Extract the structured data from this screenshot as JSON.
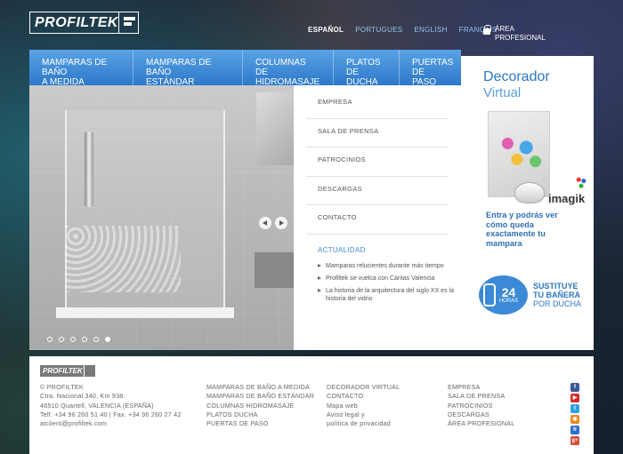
{
  "header": {
    "logo_text": "PROFILTEK",
    "languages": [
      "ESPAÑOL",
      "PORTUGUES",
      "ENGLISH",
      "FRANÇAIS"
    ],
    "area_label": "ÁREA\nPROFESIONAL"
  },
  "nav": {
    "items": [
      "MAMPARAS DE BAÑO\nA MEDIDA",
      "MAMPARAS DE BAÑO\nESTÁNDAR",
      "COLUMNAS\nDE HIDROMASAJE",
      "PLATOS\nDE DUCHA",
      "PUERTAS\nDE PASO"
    ]
  },
  "side_menu": {
    "items": [
      "EMPRESA",
      "SALA DE PRENSA",
      "PATROCINIOS",
      "DESCARGAS",
      "CONTACTO"
    ]
  },
  "news": {
    "title": "ACTUALIDAD",
    "items": [
      "Mamparas relucientes durante más tiempo",
      "Profiltek se vuelca con Cáritas Valencia",
      "La historia de la arquitectura del siglo XX es la historia del vidrio"
    ]
  },
  "right_panel": {
    "title": "Decorador",
    "subtitle": "Virtual",
    "brand": "imagik",
    "text": "Entra y podrás ver cómo queda exactamente tu mampara",
    "promo_number": "24",
    "promo_unit": "HORAS",
    "promo_line1": "SUSTITUYE",
    "promo_line2": "TU BAÑERA",
    "promo_line3": "POR DUCHA"
  },
  "footer": {
    "logo_text": "PROFILTEK",
    "address": [
      "© PROFILTEK",
      "Ctra. Nacional 340, Km 938.",
      "46510 Quartell, VALENCIA (ESPAÑA)",
      "Telf. +34 96 260 51 40 | Fax. +34 96 260 27 42",
      "atclient@profiltek.com"
    ],
    "col1": [
      "MAMPARAS DE BAÑO A MEDIDA",
      "MAMPARAS DE BAÑO ESTÁNDAR",
      "COLUMNAS HIDROMASAJE",
      "PLATOS DUCHA",
      "PUERTAS DE PASO"
    ],
    "col2": [
      "DECORADOR VIRTUAL",
      "CONTACTO",
      "Mapa web",
      "Aviso legal y",
      "política de privacidad"
    ],
    "col3": [
      "EMPRESA",
      "SALA DE PRENSA",
      "PATROCINIOS",
      "DESCARGAS",
      "ÁREA PROFESIONAL"
    ],
    "social": [
      {
        "icon": "facebook-icon",
        "glyph": "f",
        "color": "#3b5998"
      },
      {
        "icon": "youtube-icon",
        "glyph": "▶",
        "color": "#d62b2b"
      },
      {
        "icon": "twitter-icon",
        "glyph": "t",
        "color": "#2fa3e0"
      },
      {
        "icon": "rss-icon",
        "glyph": "◉",
        "color": "#f08a1e"
      },
      {
        "icon": "flickr-icon",
        "glyph": "fr",
        "color": "#2b6fc9"
      },
      {
        "icon": "google-plus-icon",
        "glyph": "g+",
        "color": "#d44a35"
      }
    ]
  },
  "slider": {
    "dot_count": 6,
    "active_dot": 5
  },
  "colors": {
    "accent": "#2b77c2",
    "nav_top": "#5aa3e6",
    "nav_bottom": "#2d78c9"
  }
}
